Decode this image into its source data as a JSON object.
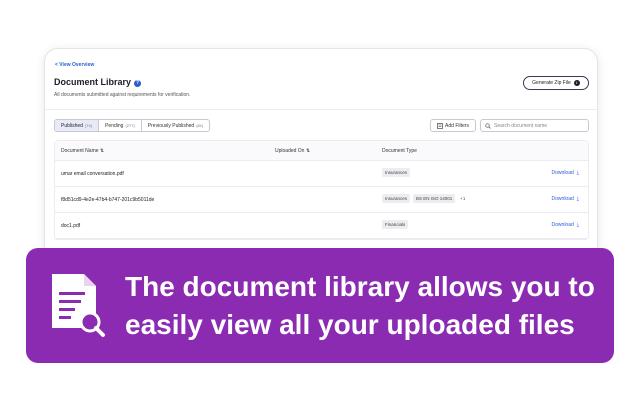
{
  "header": {
    "back_link": "< View Overview",
    "title": "Document Library",
    "subtitle": "All documents submitted against requirements for verification.",
    "zip_button": "Generate Zip File"
  },
  "tabs": [
    {
      "label": "Published",
      "count": "(74)"
    },
    {
      "label": "Pending",
      "count": "(277)"
    },
    {
      "label": "Previously Published",
      "count": "(81)"
    }
  ],
  "toolbar": {
    "filters_label": "Add Filters",
    "search_placeholder": "Search document name"
  },
  "table": {
    "columns": [
      "Document Name ⇅",
      "Uploaded On ⇅",
      "Document Type"
    ],
    "rows": [
      {
        "name": "umar email conversation.pdf",
        "types": [
          "Insurances"
        ],
        "more": "",
        "action": "Download"
      },
      {
        "name": "f8d51cd9-4e2e-47b4-b747-201c9b5011de",
        "types": [
          "Insurances",
          "BS EN ISO 14001"
        ],
        "more": "+1",
        "action": "Download"
      },
      {
        "name": "doc1.pdf",
        "types": [
          "Financials"
        ],
        "more": "",
        "action": "Download"
      }
    ]
  },
  "banner": {
    "text": "The document library allows you to easily view all your uploaded files",
    "icon": "document-search-icon",
    "color": "#8a2bb2"
  }
}
